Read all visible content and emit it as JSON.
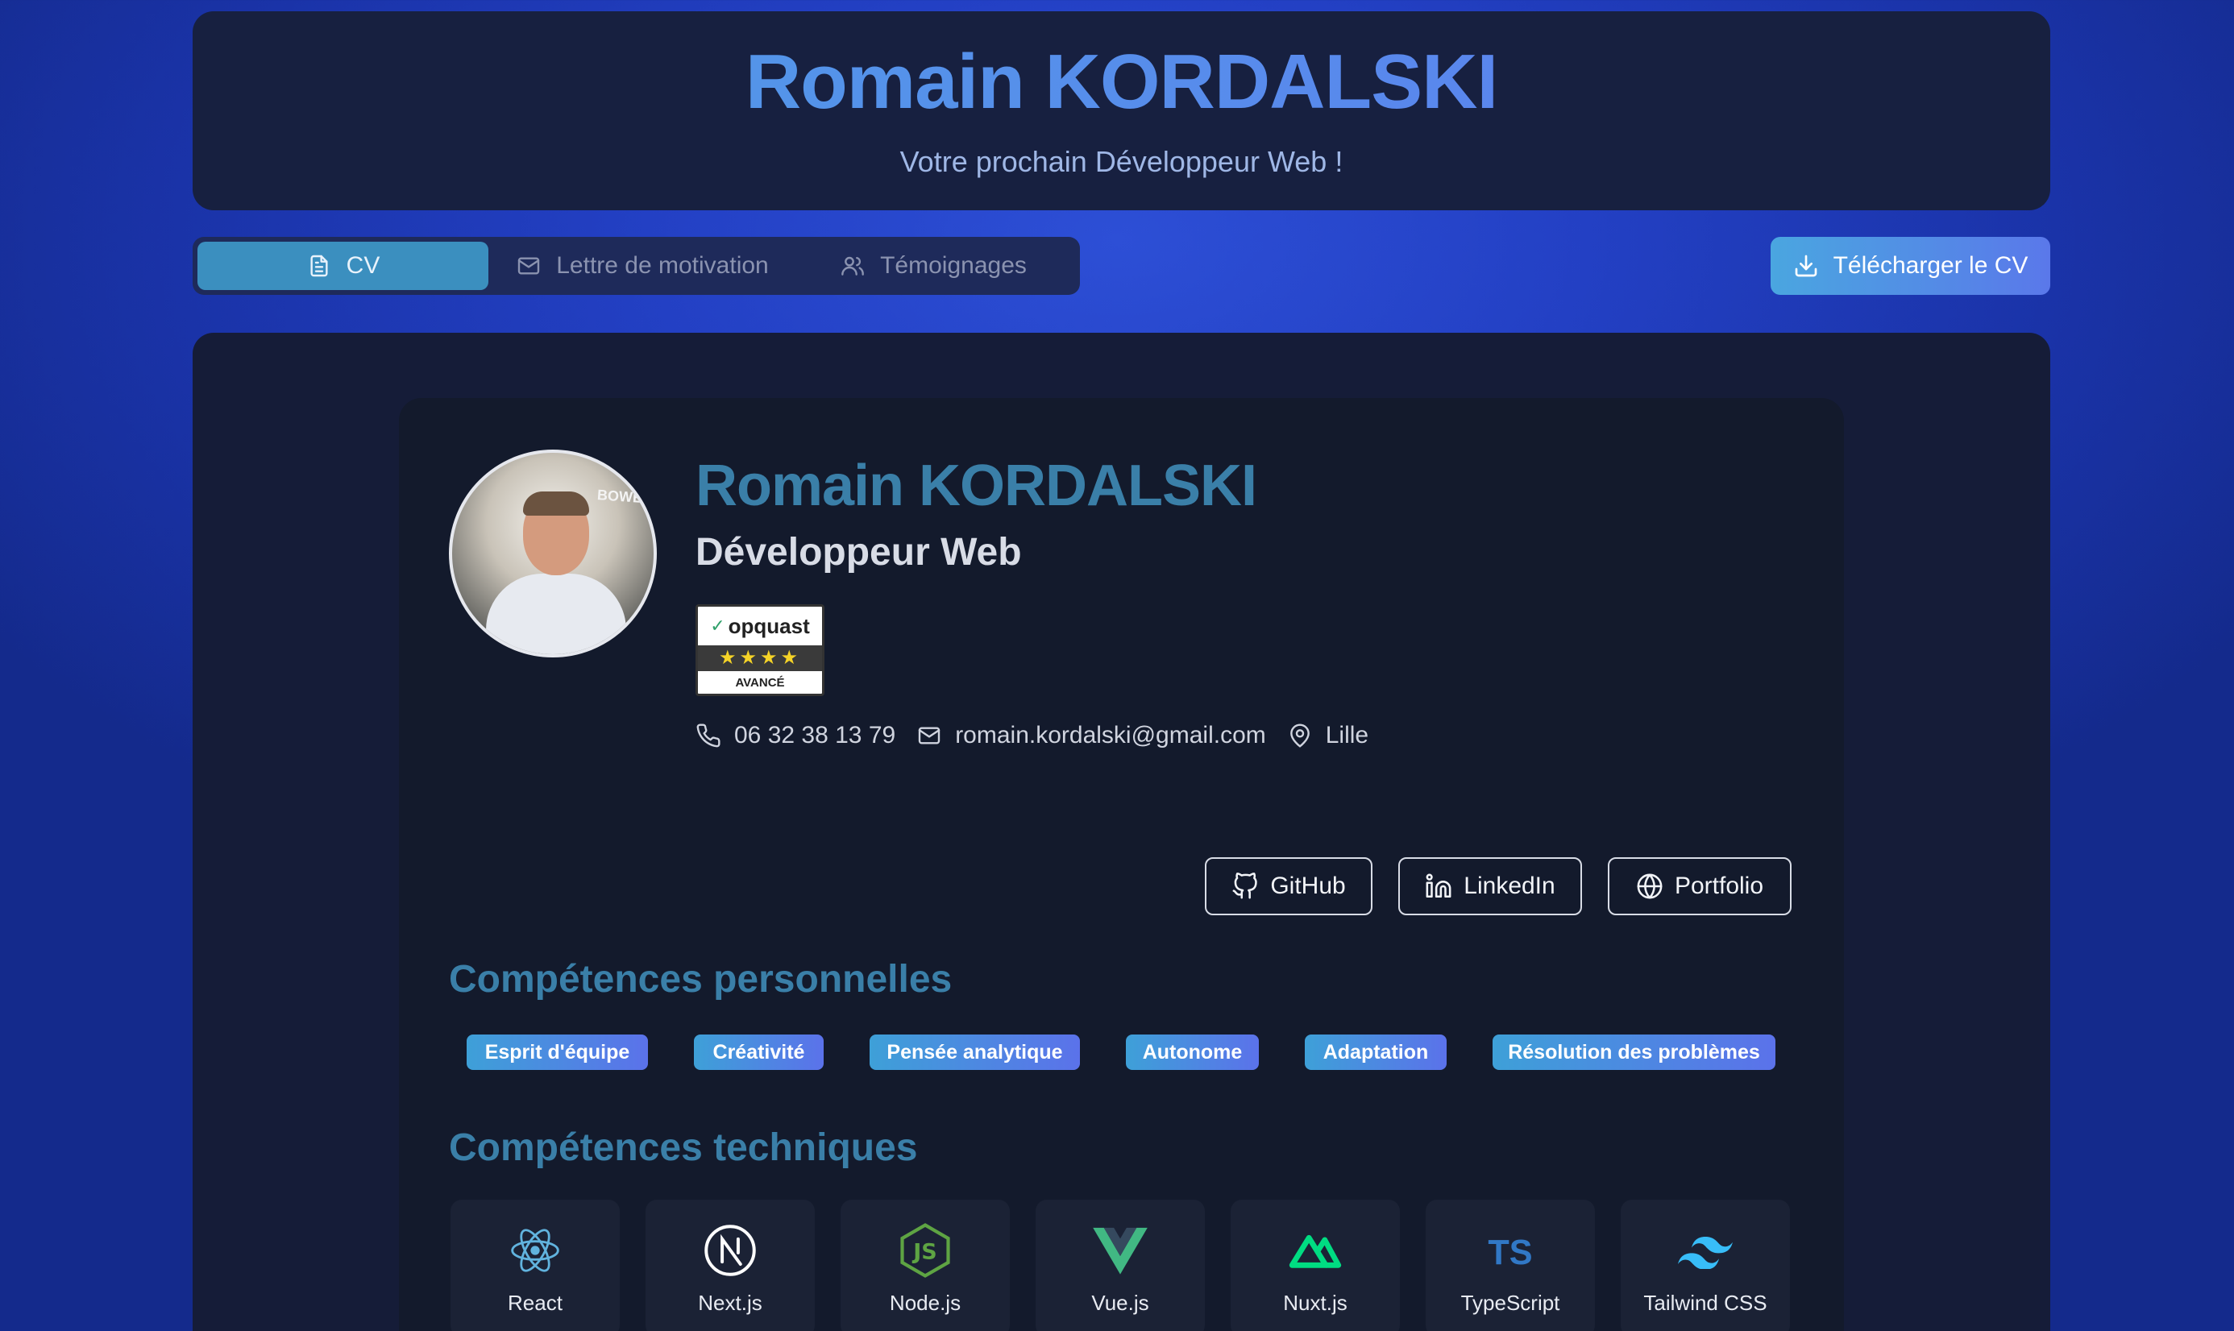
{
  "header": {
    "title": "Romain KORDALSKI",
    "subtitle": "Votre prochain Développeur Web !"
  },
  "tabs": [
    {
      "label": "CV",
      "icon": "file-icon",
      "active": true
    },
    {
      "label": "Lettre de motivation",
      "icon": "mail-icon",
      "active": false
    },
    {
      "label": "Témoignages",
      "icon": "users-icon",
      "active": false
    }
  ],
  "download": {
    "label": "Télécharger le CV",
    "icon": "download-icon"
  },
  "profile": {
    "name": "Romain KORDALSKI",
    "role": "Développeur Web",
    "avatar_text": "BOWE",
    "badge": {
      "brand": "opquast",
      "stars": "★★★★",
      "level": "AVANCÉ"
    },
    "contacts": {
      "phone": "06 32 38 13 79",
      "email": "romain.kordalski@gmail.com",
      "location": "Lille"
    },
    "links": [
      {
        "label": "GitHub",
        "icon": "github-icon"
      },
      {
        "label": "LinkedIn",
        "icon": "linkedin-icon"
      },
      {
        "label": "Portfolio",
        "icon": "globe-icon"
      }
    ]
  },
  "soft_skills": {
    "title": "Compétences personnelles",
    "items": [
      "Esprit d'équipe",
      "Créativité",
      "Pensée analytique",
      "Autonome",
      "Adaptation",
      "Résolution des problèmes"
    ]
  },
  "tech_skills": {
    "title": "Compétences techniques",
    "items": [
      {
        "label": "React",
        "icon": "react-icon"
      },
      {
        "label": "Next.js",
        "icon": "nextjs-icon"
      },
      {
        "label": "Node.js",
        "icon": "nodejs-icon"
      },
      {
        "label": "Vue.js",
        "icon": "vue-icon"
      },
      {
        "label": "Nuxt.js",
        "icon": "nuxt-icon"
      },
      {
        "label": "TypeScript",
        "icon": "typescript-icon"
      },
      {
        "label": "Tailwind CSS",
        "icon": "tailwind-icon"
      }
    ]
  },
  "colors": {
    "accent": "#3a7fa8",
    "tab_active": "#3b8fbf",
    "gradient_start": "#4aa6e0",
    "gradient_end": "#5a78ea",
    "card_bg": "#131a2c"
  }
}
